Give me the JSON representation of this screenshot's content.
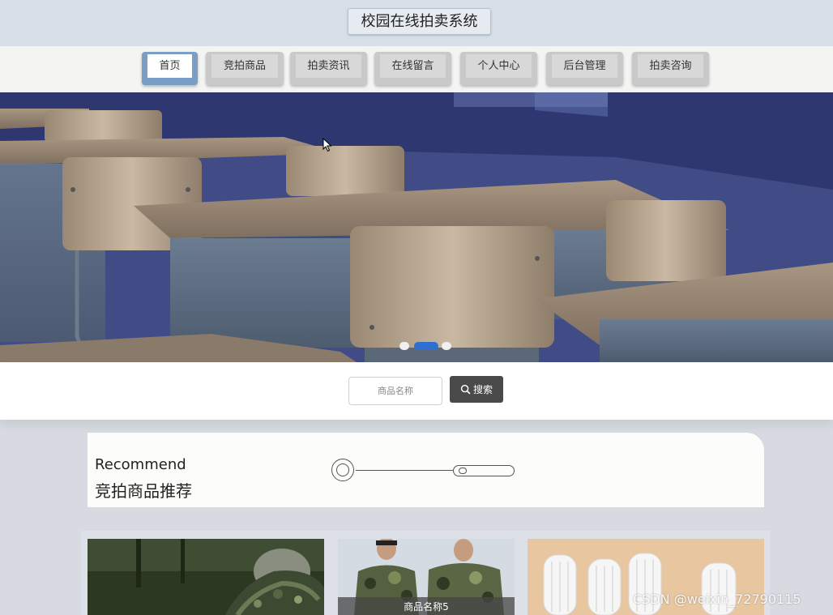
{
  "site": {
    "title": "校园在线拍卖系统"
  },
  "nav": {
    "items": [
      {
        "label": "首页",
        "active": true
      },
      {
        "label": "竞拍商品",
        "active": false
      },
      {
        "label": "拍卖资讯",
        "active": false
      },
      {
        "label": "在线留言",
        "active": false
      },
      {
        "label": "个人中心",
        "active": false
      },
      {
        "label": "后台管理",
        "active": false
      },
      {
        "label": "拍卖咨询",
        "active": false
      }
    ]
  },
  "carousel": {
    "image": "classroom-desks",
    "slides": 3,
    "active_slide": 2
  },
  "search": {
    "placeholder": "商品名称",
    "button_label": "搜索",
    "button_icon": "search-icon"
  },
  "recommend": {
    "title_en": "Recommend",
    "title_cn": "竞拍商品推荐"
  },
  "products": [
    {
      "image": "camouflage-shoes",
      "label": ""
    },
    {
      "image": "camouflage-uniforms",
      "label": "商品名称5"
    },
    {
      "image": "toothbrushes",
      "label": ""
    }
  ],
  "watermark": "CSDN @weixin_72790115",
  "colors": {
    "active_nav": "#7a9ec6",
    "search_button": "#4a4a4a",
    "header_bg": "#d6dee8"
  }
}
